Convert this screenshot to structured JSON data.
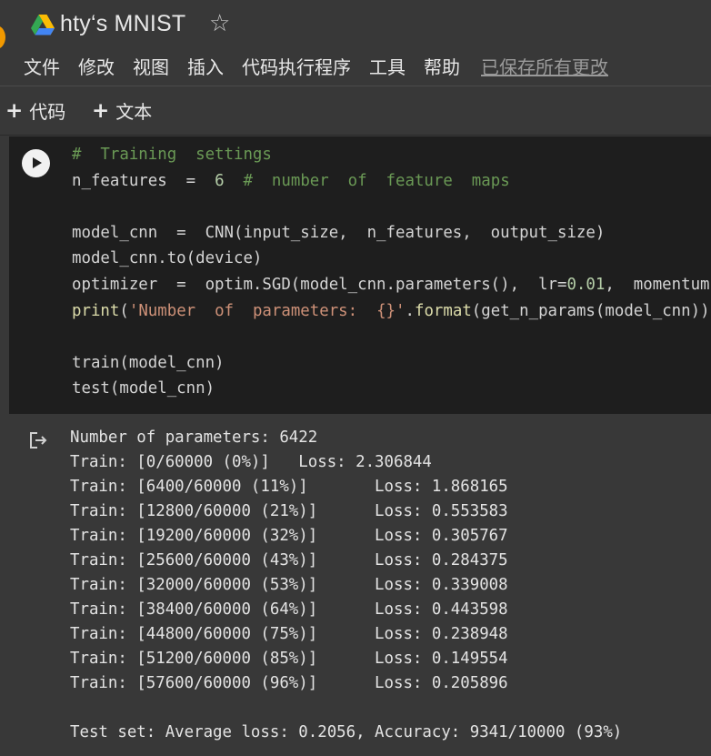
{
  "notebook": {
    "title": "hty‘s MNIST",
    "star_icon": "star-outline-icon"
  },
  "menu": {
    "items": [
      "文件",
      "修改",
      "视图",
      "插入",
      "代码执行程序",
      "工具",
      "帮助"
    ],
    "saved_status": "已保存所有更改"
  },
  "toolbar": {
    "add_code_label": "代码",
    "add_text_label": "文本"
  },
  "code_cell": {
    "lines": [
      "#  Training  settings",
      "n_features  =  6  #  number  of  feature  maps",
      "",
      "model_cnn  =  CNN(input_size,  n_features,  output_size)",
      "model_cnn.to(device)",
      "optimizer  =  optim.SGD(model_cnn.parameters(),  lr=0.01,  momentum",
      "print('Number  of  parameters:  {}'.format(get_n_params(model_cnn))",
      "",
      "train(model_cnn)",
      "test(model_cnn)"
    ]
  },
  "output": {
    "lines": [
      "Number of parameters: 6422",
      "Train: [0/60000 (0%)]   Loss: 2.306844",
      "Train: [6400/60000 (11%)]       Loss: 1.868165",
      "Train: [12800/60000 (21%)]      Loss: 0.553583",
      "Train: [19200/60000 (32%)]      Loss: 0.305767",
      "Train: [25600/60000 (43%)]      Loss: 0.284375",
      "Train: [32000/60000 (53%)]      Loss: 0.339008",
      "Train: [38400/60000 (64%)]      Loss: 0.443598",
      "Train: [44800/60000 (75%)]      Loss: 0.238948",
      "Train: [51200/60000 (85%)]      Loss: 0.149554",
      "Train: [57600/60000 (96%)]      Loss: 0.205896",
      "",
      "Test set: Average loss: 0.2056, Accuracy: 9341/10000 (93%)"
    ]
  },
  "colors": {
    "background": "#383838",
    "code_background": "#1e1e1e",
    "comment": "#6a9955",
    "string": "#ce9178",
    "number": "#b5cea8",
    "function": "#dcdcaa"
  }
}
